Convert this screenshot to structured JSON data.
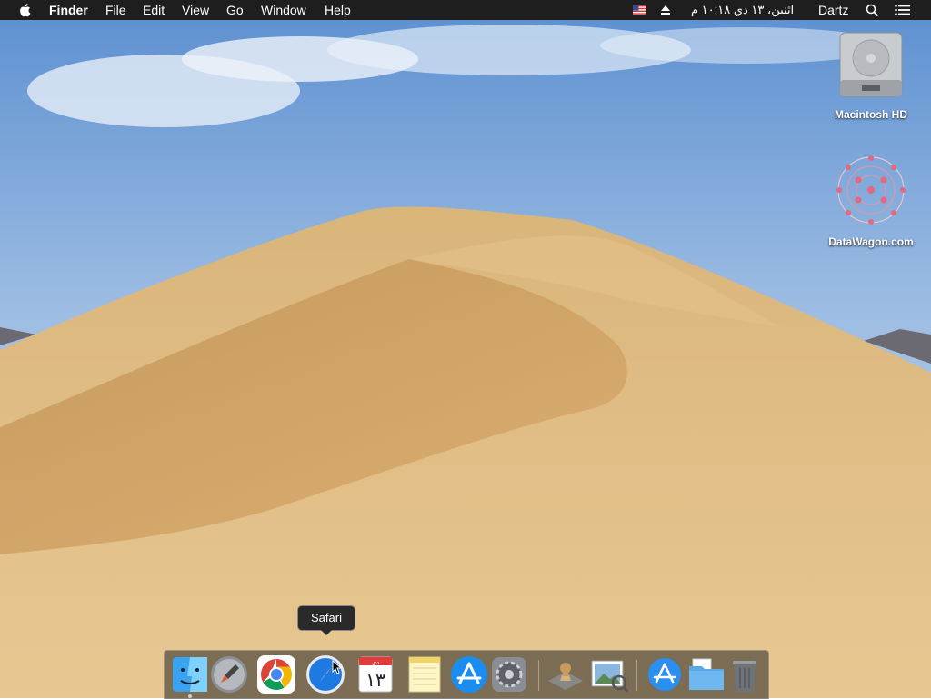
{
  "menubar": {
    "app_name": "Finder",
    "menus": [
      "File",
      "Edit",
      "View",
      "Go",
      "Window",
      "Help"
    ],
    "clock": "اثنين، ۱۳ دي  ۱۰:۱۸ م",
    "user": "Dartz"
  },
  "desktop": {
    "icons": [
      {
        "label": "Macintosh HD",
        "icon": "hard-drive-icon"
      },
      {
        "label": "DataWagon.com",
        "icon": "datawagon-icon"
      }
    ]
  },
  "dock": {
    "apps": [
      "Finder",
      "Launchpad",
      "Google Chrome",
      "Safari",
      "Calendar",
      "Notes",
      "App Store",
      "System Preferences",
      "Chess",
      "Preview",
      "Applications",
      "Documents",
      "Trash"
    ],
    "calendar_day": "۱۳",
    "calendar_month": "دي"
  },
  "tooltip": {
    "text": "Safari"
  }
}
